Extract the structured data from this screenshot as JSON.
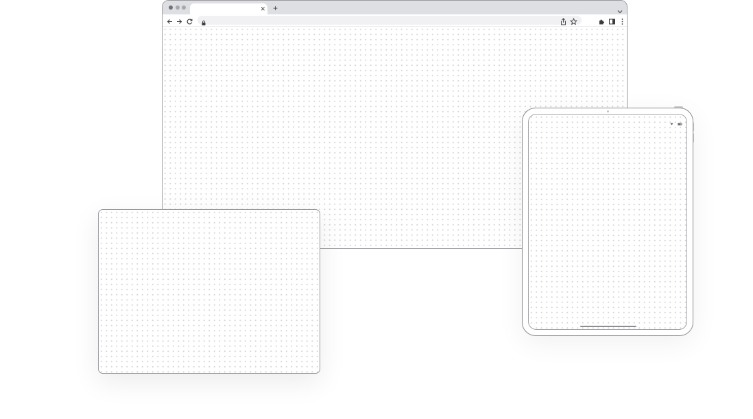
{
  "browser": {
    "tab_strip": {
      "tab": {
        "title": "",
        "close_glyph": "✕"
      },
      "new_tab_glyph": "+",
      "tab_search_icon": "chevron-down-icon"
    },
    "toolbar": {
      "back_icon": "arrow-left-icon",
      "forward_icon": "arrow-right-icon",
      "reload_icon": "reload-icon",
      "lock_icon": "lock-icon",
      "address": "",
      "share_icon": "share-icon",
      "bookmark_icon": "star-icon",
      "extensions_icon": "puzzle-icon",
      "side_panel_icon": "side-panel-icon",
      "menu_icon": "kebab-menu-icon"
    }
  },
  "devices": {
    "browser_window": "browser",
    "landscape_tablet": "tablet-landscape",
    "portrait_tablet": "ipad-portrait"
  },
  "ipad": {
    "status_icons": [
      "wifi-icon",
      "battery-icon"
    ]
  },
  "colors": {
    "frame": "#9a9a9e",
    "tab_strip": "#dedfe2",
    "dot_grid": "#d6d6d9",
    "icon": "#3c3c40"
  }
}
